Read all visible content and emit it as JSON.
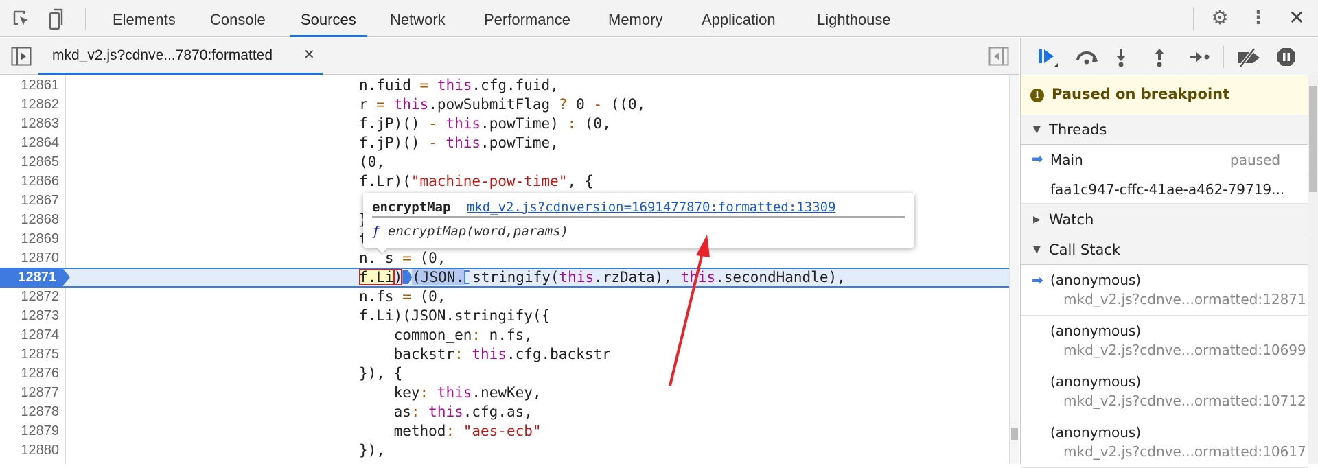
{
  "toolbar": {
    "tabs": [
      "Elements",
      "Console",
      "Sources",
      "Network",
      "Performance",
      "Memory",
      "Application",
      "Lighthouse"
    ],
    "active_tab": "Sources"
  },
  "editor": {
    "file_tab": "mkd_v2.js?cdnve...7870:formatted",
    "lines": [
      {
        "n": "12861",
        "t": "n.fuid = this.cfg.fuid,"
      },
      {
        "n": "12862",
        "t": "r = this.powSubmitFlag ? 0 - ((0,"
      },
      {
        "n": "12863",
        "t": "f.jP)() - this.powTime) : (0,"
      },
      {
        "n": "12864",
        "t": "f.jP)() - this.powTime,"
      },
      {
        "n": "12865",
        "t": "(0,"
      },
      {
        "n": "12866",
        "t": "f.Lr)(\"machine-pow-time\", {"
      },
      {
        "n": "12867",
        "t": "    ti"
      },
      {
        "n": "12868",
        "t": "}"
      },
      {
        "n": "12869",
        "t": "t"
      },
      {
        "n": "12870",
        "t": "n. s = (0,"
      },
      {
        "n": "12871",
        "t": ""
      },
      {
        "n": "12872",
        "t": "n.fs = (0,"
      },
      {
        "n": "12873",
        "t": "f.Li)(JSON.stringify({"
      },
      {
        "n": "12874",
        "t": "    common_en: n.fs,"
      },
      {
        "n": "12875",
        "t": "    backstr: this.cfg.backstr"
      },
      {
        "n": "12876",
        "t": "}), {"
      },
      {
        "n": "12877",
        "t": "    key: this.newKey,"
      },
      {
        "n": "12878",
        "t": "    as: this.cfg.as,"
      },
      {
        "n": "12879",
        "t": "    method: \"aes-ecb\""
      },
      {
        "n": "12880",
        "t": "}),"
      }
    ],
    "exec_line": {
      "number": "12871",
      "callee": "f.Li",
      "paren": ")",
      "json": "(JSON.",
      "rest_fn": "stringify(",
      "kw1": "this",
      "mid": ".rzData), ",
      "kw2": "this",
      "end": ".secondHandle),"
    }
  },
  "popover": {
    "name": "encryptMap",
    "location": "mkd_v2.js?cdnversion=1691477870:formatted:13309",
    "f_glyph": "ƒ",
    "signature": "encryptMap(word,params)"
  },
  "debugger": {
    "banner": "Paused on breakpoint",
    "threads_label": "Threads",
    "threads": [
      {
        "name": "Main",
        "status": "paused"
      },
      {
        "name": "faa1c947-cffc-41ae-a462-79719...",
        "status": ""
      }
    ],
    "watch_label": "Watch",
    "callstack_label": "Call Stack",
    "frames": [
      {
        "fn": "(anonymous)",
        "loc": "mkd_v2.js?cdnve...ormatted:12871"
      },
      {
        "fn": "(anonymous)",
        "loc": "mkd_v2.js?cdnve...ormatted:10699"
      },
      {
        "fn": "(anonymous)",
        "loc": "mkd_v2.js?cdnve...ormatted:10712"
      },
      {
        "fn": "(anonymous)",
        "loc": "mkd_v2.js?cdnve...ormatted:10617"
      }
    ]
  },
  "colors": {
    "accent": "#1a73e8",
    "exec_line": "#3e7be0",
    "banner_bg": "#fffbe5",
    "annotation_arrow": "#e8232a"
  }
}
